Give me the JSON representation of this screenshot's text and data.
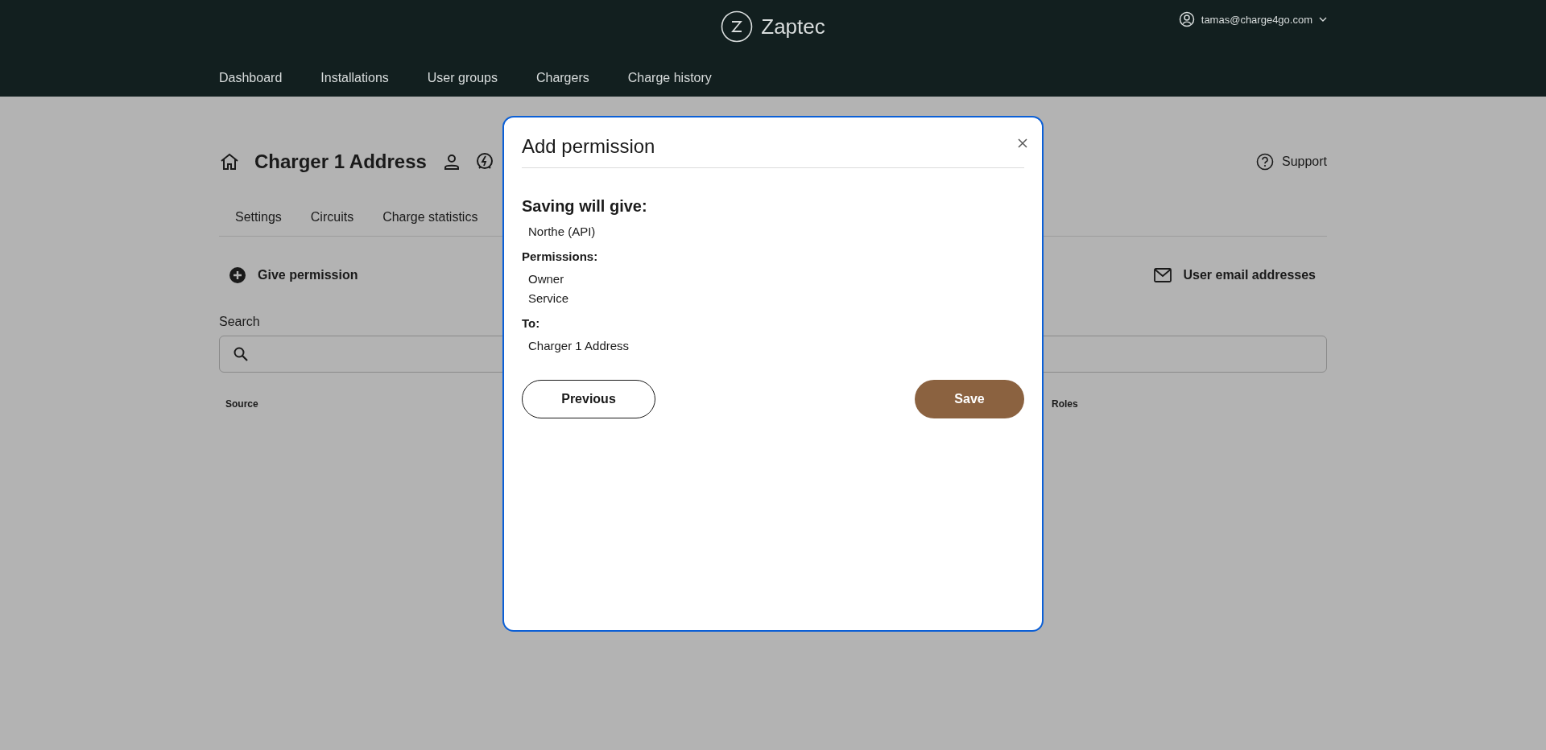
{
  "header": {
    "brand": "Zaptec",
    "user_email": "tamas@charge4go.com",
    "nav": [
      {
        "label": "Dashboard"
      },
      {
        "label": "Installations"
      },
      {
        "label": "User groups"
      },
      {
        "label": "Chargers"
      },
      {
        "label": "Charge history"
      }
    ]
  },
  "page": {
    "title": "Charger 1 Address",
    "support": "Support",
    "tabs": [
      {
        "label": "Settings"
      },
      {
        "label": "Circuits"
      },
      {
        "label": "Charge statistics"
      }
    ],
    "give_permission": "Give permission",
    "user_emails": "User email addresses",
    "search_label": "Search",
    "columns": [
      "Source",
      "Roles"
    ]
  },
  "dialog": {
    "title": "Add permission",
    "sections": [
      {
        "kind": "lead",
        "heading": "Saving will give:",
        "items": [
          "Northe (API)"
        ]
      },
      {
        "kind": "sub",
        "heading": "Permissions:",
        "items": [
          "Owner",
          "Service"
        ]
      },
      {
        "kind": "sub",
        "heading": "To:",
        "items": [
          "Charger 1 Address"
        ]
      }
    ],
    "buttons": [
      {
        "kind": "secondary",
        "label": "Previous"
      },
      {
        "kind": "primary",
        "label": "Save"
      }
    ]
  }
}
